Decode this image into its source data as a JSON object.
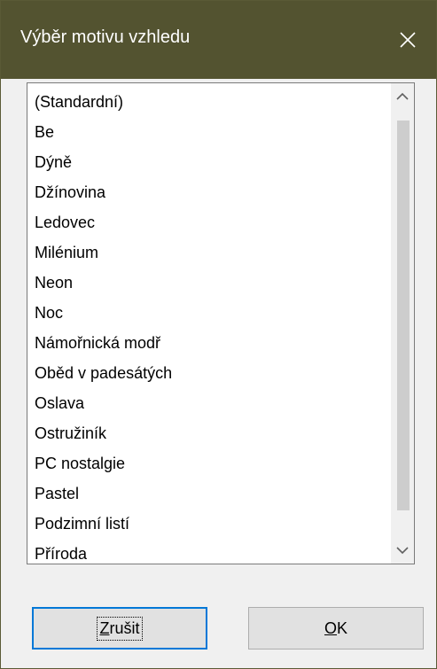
{
  "dialog": {
    "title": "Výběr motivu vzhledu",
    "close_icon": "close-icon"
  },
  "themes": {
    "items": [
      "(Standardní)",
      "Be",
      "Dýně",
      "Džínovina",
      "Ledovec",
      "Milénium",
      "Neon",
      "Noc",
      "Námořnická modř",
      "Oběd v padesátých",
      "Oslava",
      "Ostružiník",
      "PC nostalgie",
      "Pastel",
      "Podzimní listí",
      "Příroda"
    ]
  },
  "buttons": {
    "cancel_mnemonic": "Z",
    "cancel_rest": "rušit",
    "ok_mnemonic": "O",
    "ok_rest": "K"
  },
  "colors": {
    "titlebar": "#535330",
    "focus_border": "#0078d7"
  }
}
